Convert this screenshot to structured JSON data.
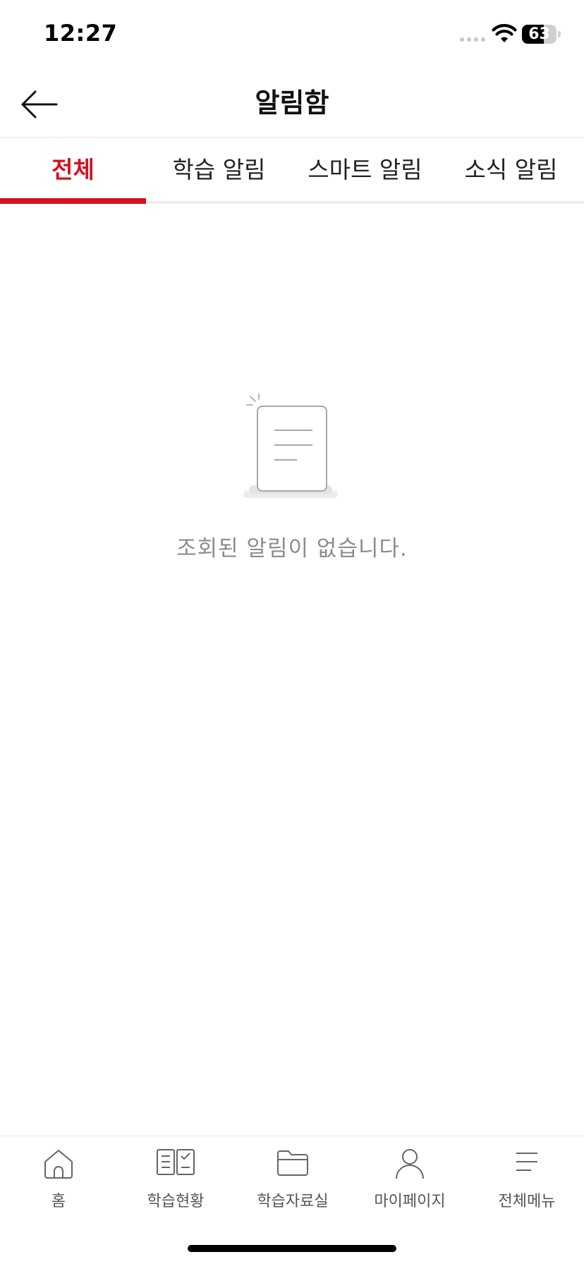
{
  "status_bar": {
    "time": "12:27",
    "battery": "63",
    "battery_level": 0.63
  },
  "header": {
    "title": "알림함",
    "back_icon": "arrow-left-icon"
  },
  "tabs": [
    {
      "label": "전체",
      "active": true
    },
    {
      "label": "학습 알림",
      "active": false
    },
    {
      "label": "스마트 알림",
      "active": false
    },
    {
      "label": "소식 알림",
      "active": false
    }
  ],
  "empty_state": {
    "icon": "empty-document-icon",
    "message": "조회된 알림이 없습니다."
  },
  "bottom_nav": [
    {
      "label": "홈",
      "icon": "home-icon"
    },
    {
      "label": "학습현황",
      "icon": "study-status-icon"
    },
    {
      "label": "학습자료실",
      "icon": "folder-icon"
    },
    {
      "label": "마이페이지",
      "icon": "person-icon"
    },
    {
      "label": "전체메뉴",
      "icon": "menu-icon"
    }
  ],
  "colors": {
    "accent": "#d6101f",
    "muted_text": "#8c8c8c"
  }
}
